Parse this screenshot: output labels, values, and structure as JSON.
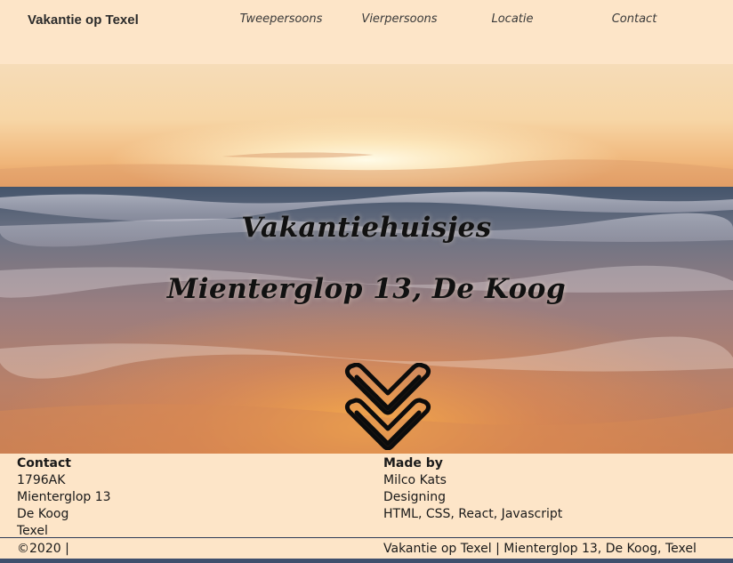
{
  "navbar": {
    "brand": "Vakantie op Texel",
    "links": [
      "Tweepersoons",
      "Vierpersoons",
      "Locatie",
      "Contact"
    ]
  },
  "hero": {
    "title": "Vakantiehuisjes",
    "address": "Mienterglop 13, De Koog",
    "scroll_icon": "double-chevron-down-icon"
  },
  "footer": {
    "contact": {
      "heading": "Contact",
      "lines": [
        "1796AK",
        "Mienterglop 13",
        "De Koog",
        "Texel"
      ]
    },
    "made_by": {
      "heading": "Made by",
      "lines": [
        "Milco Kats",
        "Designing",
        "HTML, CSS, React, Javascript"
      ]
    },
    "copyright": "©2020 |",
    "tagline": "Vakantie op Texel | Mienterglop 13, De Koog, Texel"
  },
  "colors": {
    "background": "#fde5c8",
    "text": "#1c1c1c",
    "divider": "#2d3b58"
  }
}
